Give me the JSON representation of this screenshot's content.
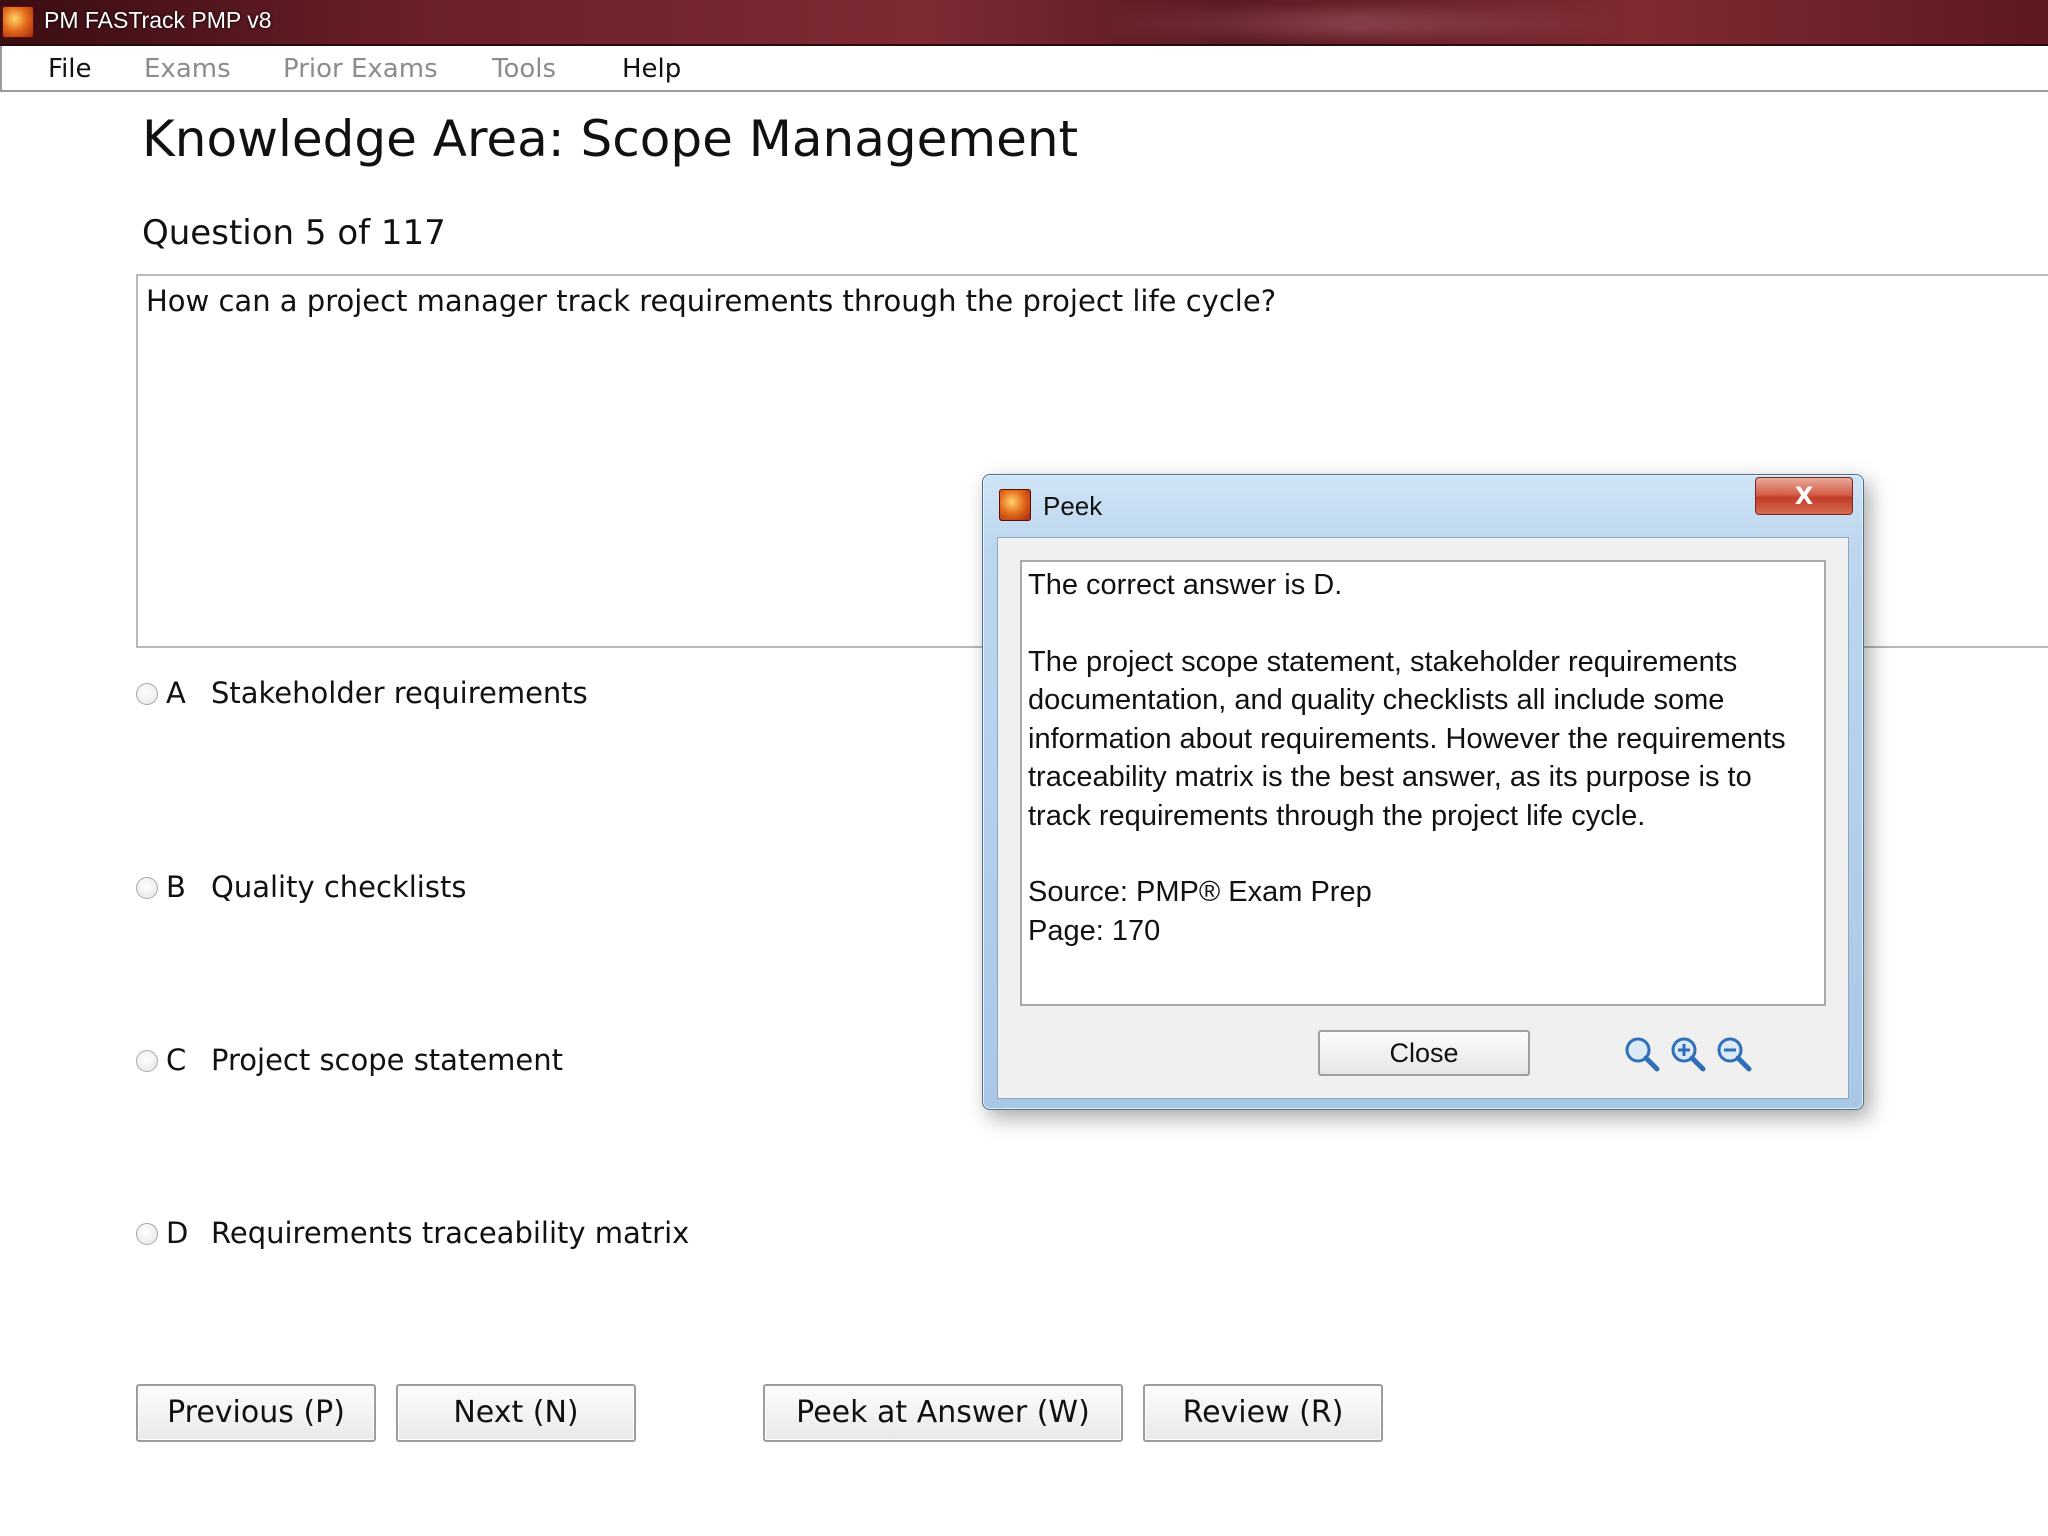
{
  "window": {
    "title": "PM FASTrack PMP v8"
  },
  "menu": [
    {
      "label": "File",
      "enabled": true
    },
    {
      "label": "Exams",
      "enabled": false
    },
    {
      "label": "Prior Exams",
      "enabled": false
    },
    {
      "label": "Tools",
      "enabled": false
    },
    {
      "label": "Help",
      "enabled": true
    }
  ],
  "main": {
    "heading": "Knowledge Area: Scope Management",
    "question_counter": "Question 5 of 117",
    "question_text": "How can a project manager track requirements through the project life cycle?",
    "options": [
      {
        "letter": "A",
        "text": "Stakeholder requirements"
      },
      {
        "letter": "B",
        "text": "Quality checklists"
      },
      {
        "letter": "C",
        "text": "Project scope statement"
      },
      {
        "letter": "D",
        "text": "Requirements traceability matrix"
      }
    ],
    "buttons": {
      "previous": "Previous (P)",
      "next": "Next (N)",
      "peek": "Peek at Answer (W)",
      "review": "Review (R)"
    }
  },
  "peek_dialog": {
    "title": "Peek",
    "close_x": "X",
    "answer_line": "The correct answer is D.",
    "explanation_lines": [
      "The project scope statement, stakeholder requirements",
      "documentation, and quality checklists all include some",
      "information about requirements. However the requirements",
      "traceability matrix is the best answer, as its purpose is to",
      "track requirements through the project life cycle."
    ],
    "source": "Source: PMP® Exam Prep",
    "page": "Page: 170",
    "close_button": "Close",
    "icons": [
      "magnifier-icon",
      "zoom-in-icon",
      "zoom-out-icon"
    ]
  },
  "colors": {
    "title_bar": "#6b1f28",
    "dialog_frame": "#bcd6ee",
    "close_x_red": "#c23d28",
    "zoom_icon_blue": "#2f6fb8"
  }
}
